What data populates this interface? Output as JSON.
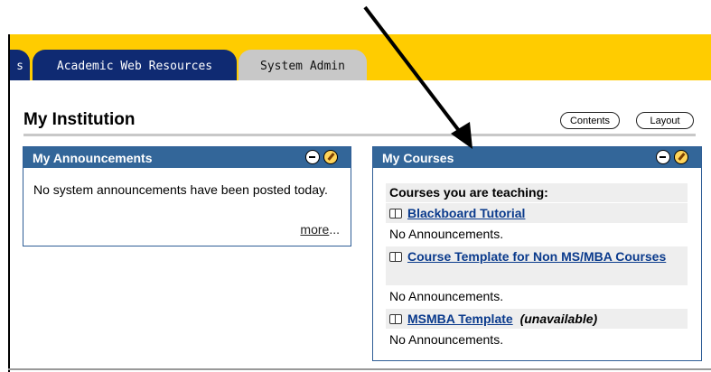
{
  "nav": {
    "tabs": [
      {
        "label": "s"
      },
      {
        "label": "Academic Web Resources"
      },
      {
        "label": "System Admin"
      }
    ]
  },
  "page": {
    "title": "My Institution",
    "buttons": {
      "contents": "Contents",
      "layout": "Layout"
    }
  },
  "announcements": {
    "title": "My Announcements",
    "text": "No system announcements have been posted today.",
    "more": "more",
    "ellipsis": "..."
  },
  "courses": {
    "title": "My Courses",
    "section": "Courses you are teaching:",
    "items": [
      {
        "name": "Blackboard Tutorial",
        "status": "",
        "announcement": "No Announcements."
      },
      {
        "name": "Course Template for Non MS/MBA Courses",
        "status": "",
        "announcement": "No Announcements."
      },
      {
        "name": "MSMBA Template",
        "status": "(unavailable)",
        "announcement": "No Announcements."
      }
    ]
  },
  "colors": {
    "topband": "#ffcc00",
    "tab_active": "#0f2a72",
    "tab_inactive": "#c8c8c8",
    "module_header": "#336699",
    "link": "#0a3a8c"
  }
}
